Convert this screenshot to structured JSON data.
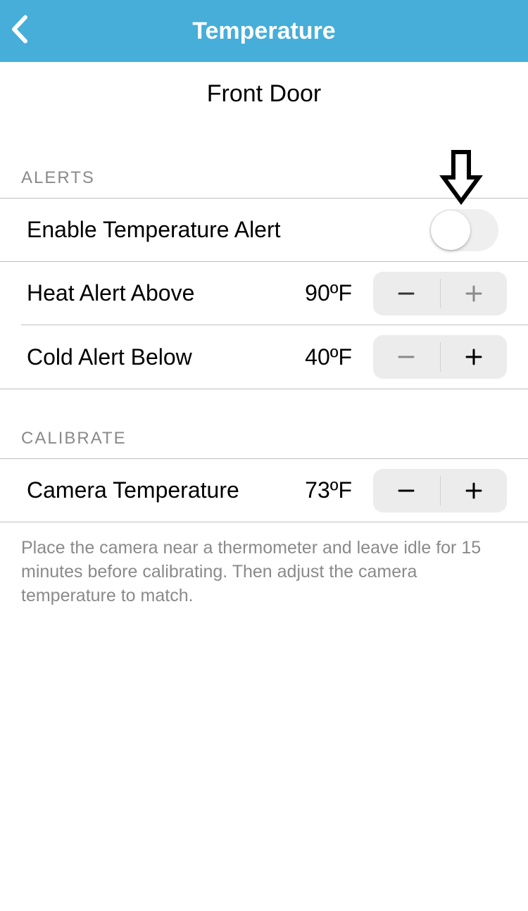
{
  "header": {
    "title": "Temperature"
  },
  "device_name": "Front Door",
  "sections": {
    "alerts": {
      "heading": "ALERTS",
      "enable_label": "Enable Temperature Alert",
      "heat": {
        "label": "Heat Alert Above",
        "value": "90",
        "unit": "ºF"
      },
      "cold": {
        "label": "Cold Alert Below",
        "value": "40",
        "unit": "ºF"
      }
    },
    "calibrate": {
      "heading": "CALIBRATE",
      "camera": {
        "label": "Camera Temperature",
        "value": "73",
        "unit": "ºF"
      },
      "footer": "Place the camera near a thermometer and leave idle for 15 minutes before calibrating. Then adjust the camera temperature to match."
    }
  },
  "icons": {
    "back": "chevron-left",
    "minus": "minus",
    "plus": "plus",
    "annotation": "down-arrow"
  },
  "colors": {
    "header_bg": "#46aed9",
    "text_muted": "#8a8a8a",
    "stepper_bg": "#ececec",
    "divider": "#bfbfbf"
  }
}
